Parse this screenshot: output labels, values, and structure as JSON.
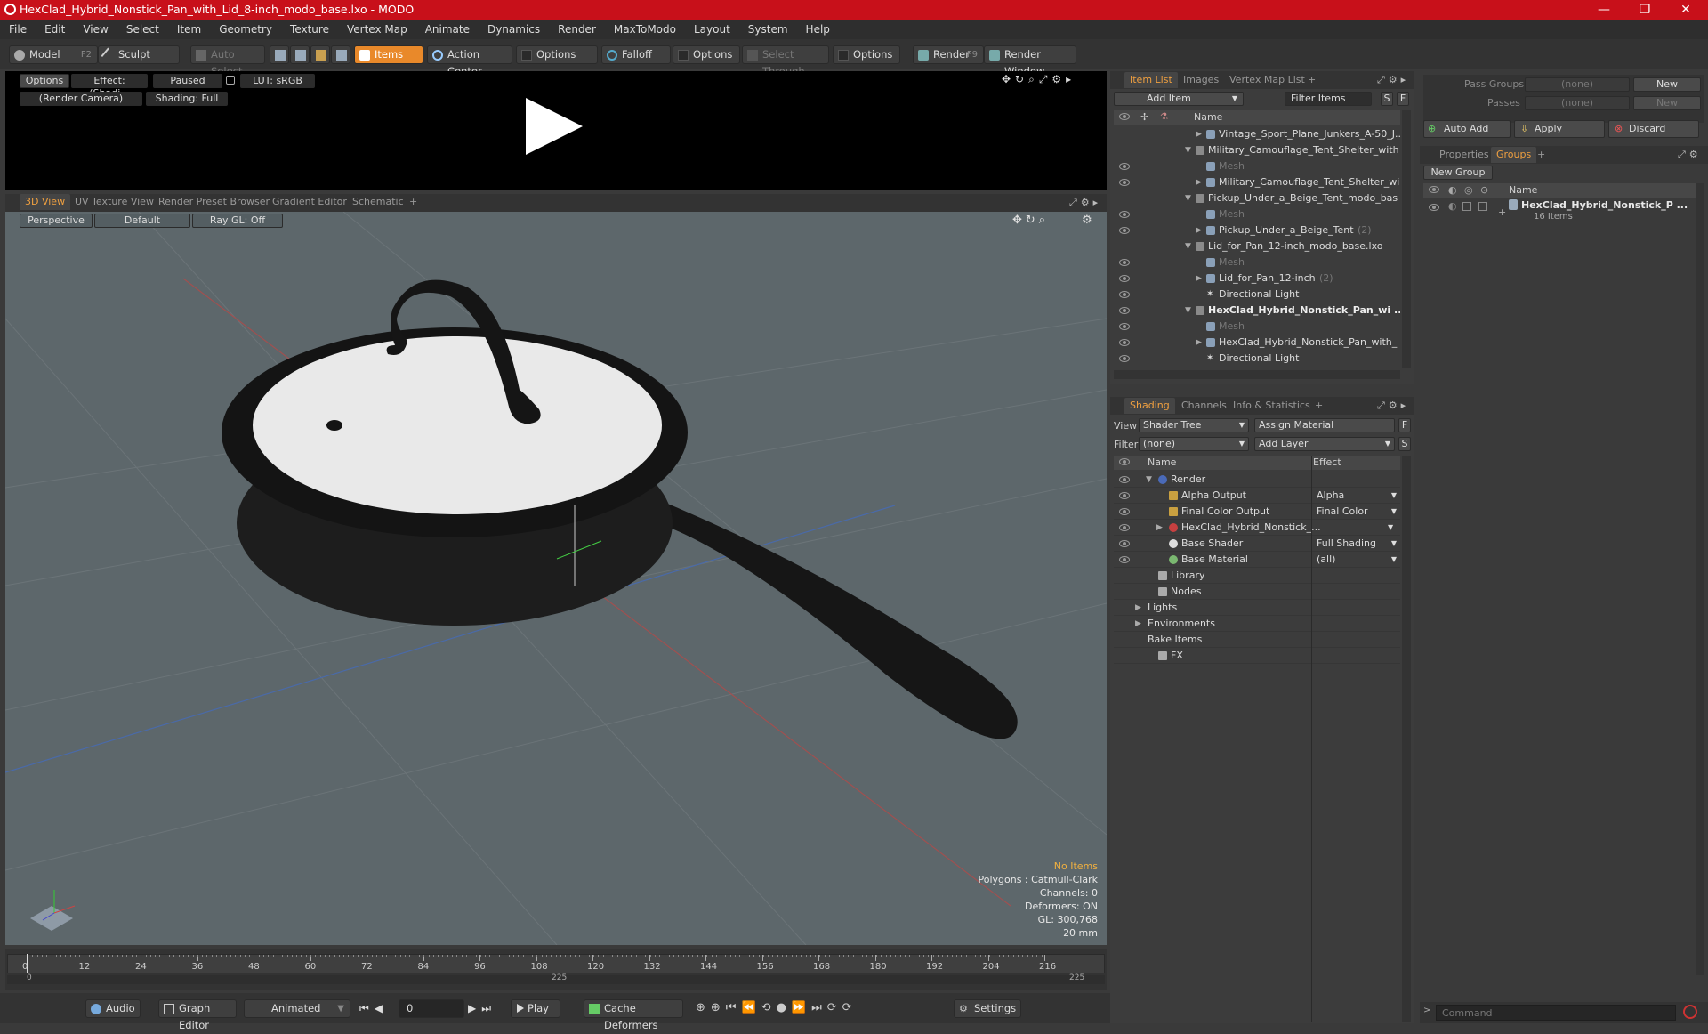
{
  "window": {
    "title": "HexClad_Hybrid_Nonstick_Pan_with_Lid_8-inch_modo_base.lxo - MODO",
    "minimize": "—",
    "maximize": "❐",
    "close": "✕"
  },
  "menu": [
    "File",
    "Edit",
    "View",
    "Select",
    "Item",
    "Geometry",
    "Texture",
    "Vertex Map",
    "Animate",
    "Dynamics",
    "Render",
    "MaxToModo",
    "Layout",
    "System",
    "Help"
  ],
  "toolbar": {
    "model": "Model",
    "model_key": "F2",
    "sculpt": "Sculpt",
    "auto_select": "Auto Select",
    "items": "Items",
    "action_center": "Action Center",
    "options1": "Options",
    "falloff": "Falloff",
    "options2": "Options",
    "select_through": "Select Through",
    "options3": "Options",
    "render": "Render",
    "render_key": "F9",
    "render_window": "Render Window"
  },
  "preview": {
    "options": "Options",
    "effect": "Effect: (Shadi...",
    "paused": "Paused",
    "lut": "LUT: sRGB",
    "camera": "(Render Camera)",
    "shading": "Shading: Full"
  },
  "viewport_tabs": [
    "3D View",
    "UV Texture View",
    "Render Preset Browser",
    "Gradient Editor",
    "Schematic",
    "+"
  ],
  "viewport": {
    "perspective": "Perspective",
    "default": "Default",
    "raygl": "Ray GL: Off",
    "info": {
      "no_items": "No Items",
      "polygons": "Polygons : Catmull-Clark",
      "channels": "Channels: 0",
      "deformers": "Deformers: ON",
      "gl": "GL: 300,768",
      "scale": "20 mm"
    }
  },
  "timeline": {
    "ticks": [
      "0",
      "12",
      "24",
      "36",
      "48",
      "60",
      "72",
      "84",
      "96",
      "108",
      "120",
      "132",
      "144",
      "156",
      "168",
      "180",
      "192",
      "204",
      "216"
    ],
    "start": "0",
    "mid": "225",
    "end": "225"
  },
  "bottombar": {
    "audio": "Audio",
    "graph_editor": "Graph Editor",
    "animated": "Animated",
    "frame": "0",
    "play": "Play",
    "cache": "Cache Deformers",
    "settings": "Settings"
  },
  "itemlist": {
    "tabs": [
      "Item List",
      "Images",
      "Vertex Map List",
      "+"
    ],
    "add_item": "Add Item",
    "filter": "Filter Items",
    "s": "S",
    "f": "F",
    "col_name": "Name",
    "rows": [
      {
        "label": "Vintage_Sport_Plane_Junkers_A-50_J...",
        "indent": 2,
        "arrow": "▶",
        "icon": "mesh",
        "eye": false,
        "dim": false,
        "bold": false
      },
      {
        "label": "Military_Camouflage_Tent_Shelter_with ...",
        "indent": 1,
        "arrow": "▼",
        "icon": "scene",
        "eye": false,
        "dim": false,
        "bold": false
      },
      {
        "label": "Mesh",
        "indent": 2,
        "arrow": "",
        "icon": "mesh",
        "eye": true,
        "dim": true,
        "bold": false
      },
      {
        "label": "Military_Camouflage_Tent_Shelter_wi ...",
        "indent": 2,
        "arrow": "▶",
        "icon": "mesh",
        "eye": true,
        "dim": false,
        "bold": false
      },
      {
        "label": "Pickup_Under_a_Beige_Tent_modo_bas ...",
        "indent": 1,
        "arrow": "▼",
        "icon": "scene",
        "eye": false,
        "dim": false,
        "bold": false
      },
      {
        "label": "Mesh",
        "indent": 2,
        "arrow": "",
        "icon": "mesh",
        "eye": true,
        "dim": true,
        "bold": false
      },
      {
        "label": "Pickup_Under_a_Beige_Tent",
        "count": "(2)",
        "indent": 2,
        "arrow": "▶",
        "icon": "mesh",
        "eye": true,
        "dim": false,
        "bold": false
      },
      {
        "label": "Lid_for_Pan_12-inch_modo_base.lxo",
        "indent": 1,
        "arrow": "▼",
        "icon": "scene",
        "eye": false,
        "dim": false,
        "bold": false
      },
      {
        "label": "Mesh",
        "indent": 2,
        "arrow": "",
        "icon": "mesh",
        "eye": true,
        "dim": true,
        "bold": false
      },
      {
        "label": "Lid_for_Pan_12-inch",
        "count": "(2)",
        "indent": 2,
        "arrow": "▶",
        "icon": "mesh",
        "eye": true,
        "dim": false,
        "bold": false
      },
      {
        "label": "Directional Light",
        "indent": 2,
        "arrow": "",
        "icon": "light",
        "eye": true,
        "dim": false,
        "bold": false
      },
      {
        "label": "HexClad_Hybrid_Nonstick_Pan_wi ...",
        "indent": 1,
        "arrow": "▼",
        "icon": "scene",
        "eye": true,
        "dim": false,
        "bold": true
      },
      {
        "label": "Mesh",
        "indent": 2,
        "arrow": "",
        "icon": "mesh",
        "eye": true,
        "dim": true,
        "bold": false
      },
      {
        "label": "HexClad_Hybrid_Nonstick_Pan_with_ ...",
        "indent": 2,
        "arrow": "▶",
        "icon": "mesh",
        "eye": true,
        "dim": false,
        "bold": false
      },
      {
        "label": "Directional Light",
        "indent": 2,
        "arrow": "",
        "icon": "light",
        "eye": true,
        "dim": false,
        "bold": false
      }
    ]
  },
  "shading": {
    "tabs": [
      "Shading",
      "Channels",
      "Info & Statistics",
      "+"
    ],
    "view_label": "View",
    "view_value": "Shader Tree",
    "assign": "Assign Material",
    "f": "F",
    "filter_label": "Filter",
    "filter_value": "(none)",
    "add_layer": "Add Layer",
    "s": "S",
    "col_name": "Name",
    "col_effect": "Effect",
    "rows": [
      {
        "label": "Render",
        "effect": "",
        "indent": 0,
        "arrow": "▼",
        "icon": "render",
        "eye": true
      },
      {
        "label": "Alpha Output",
        "effect": "Alpha",
        "indent": 1,
        "arrow": "",
        "icon": "output",
        "eye": true
      },
      {
        "label": "Final Color Output",
        "effect": "Final Color",
        "indent": 1,
        "arrow": "",
        "icon": "output",
        "eye": true
      },
      {
        "label": "HexClad_Hybrid_Nonstick_...",
        "effect": "",
        "indent": 1,
        "arrow": "▶",
        "icon": "mat",
        "eye": true
      },
      {
        "label": "Base Shader",
        "effect": "Full Shading",
        "indent": 1,
        "arrow": "",
        "icon": "shader",
        "eye": true
      },
      {
        "label": "Base Material",
        "effect": "(all)",
        "indent": 1,
        "arrow": "",
        "icon": "basemat",
        "eye": true
      },
      {
        "label": "Library",
        "effect": "",
        "indent": 0,
        "arrow": "",
        "icon": "folder",
        "eye": false
      },
      {
        "label": "Nodes",
        "effect": "",
        "indent": 0,
        "arrow": "",
        "icon": "folder",
        "eye": false
      },
      {
        "label": "Lights",
        "effect": "",
        "indent": -1,
        "arrow": "▶",
        "icon": "",
        "eye": false
      },
      {
        "label": "Environments",
        "effect": "",
        "indent": -1,
        "arrow": "▶",
        "icon": "",
        "eye": false
      },
      {
        "label": "Bake Items",
        "effect": "",
        "indent": -1,
        "arrow": "",
        "icon": "",
        "eye": false
      },
      {
        "label": "FX",
        "effect": "",
        "indent": 0,
        "arrow": "",
        "icon": "fx",
        "eye": false
      }
    ]
  },
  "groups": {
    "pass_groups_label": "Pass Groups",
    "pass_groups_value": "(none)",
    "new1": "New",
    "passes_label": "Passes",
    "passes_value": "(none)",
    "new2": "New",
    "auto_add": "Auto Add",
    "apply": "Apply",
    "discard": "Discard",
    "tabs": [
      "Properties",
      "Groups",
      "+"
    ],
    "new_group": "New Group",
    "col_name": "Name",
    "group_name": "HexClad_Hybrid_Nonstick_P ...",
    "group_count": "16 Items"
  },
  "command": {
    "placeholder": "Command"
  }
}
